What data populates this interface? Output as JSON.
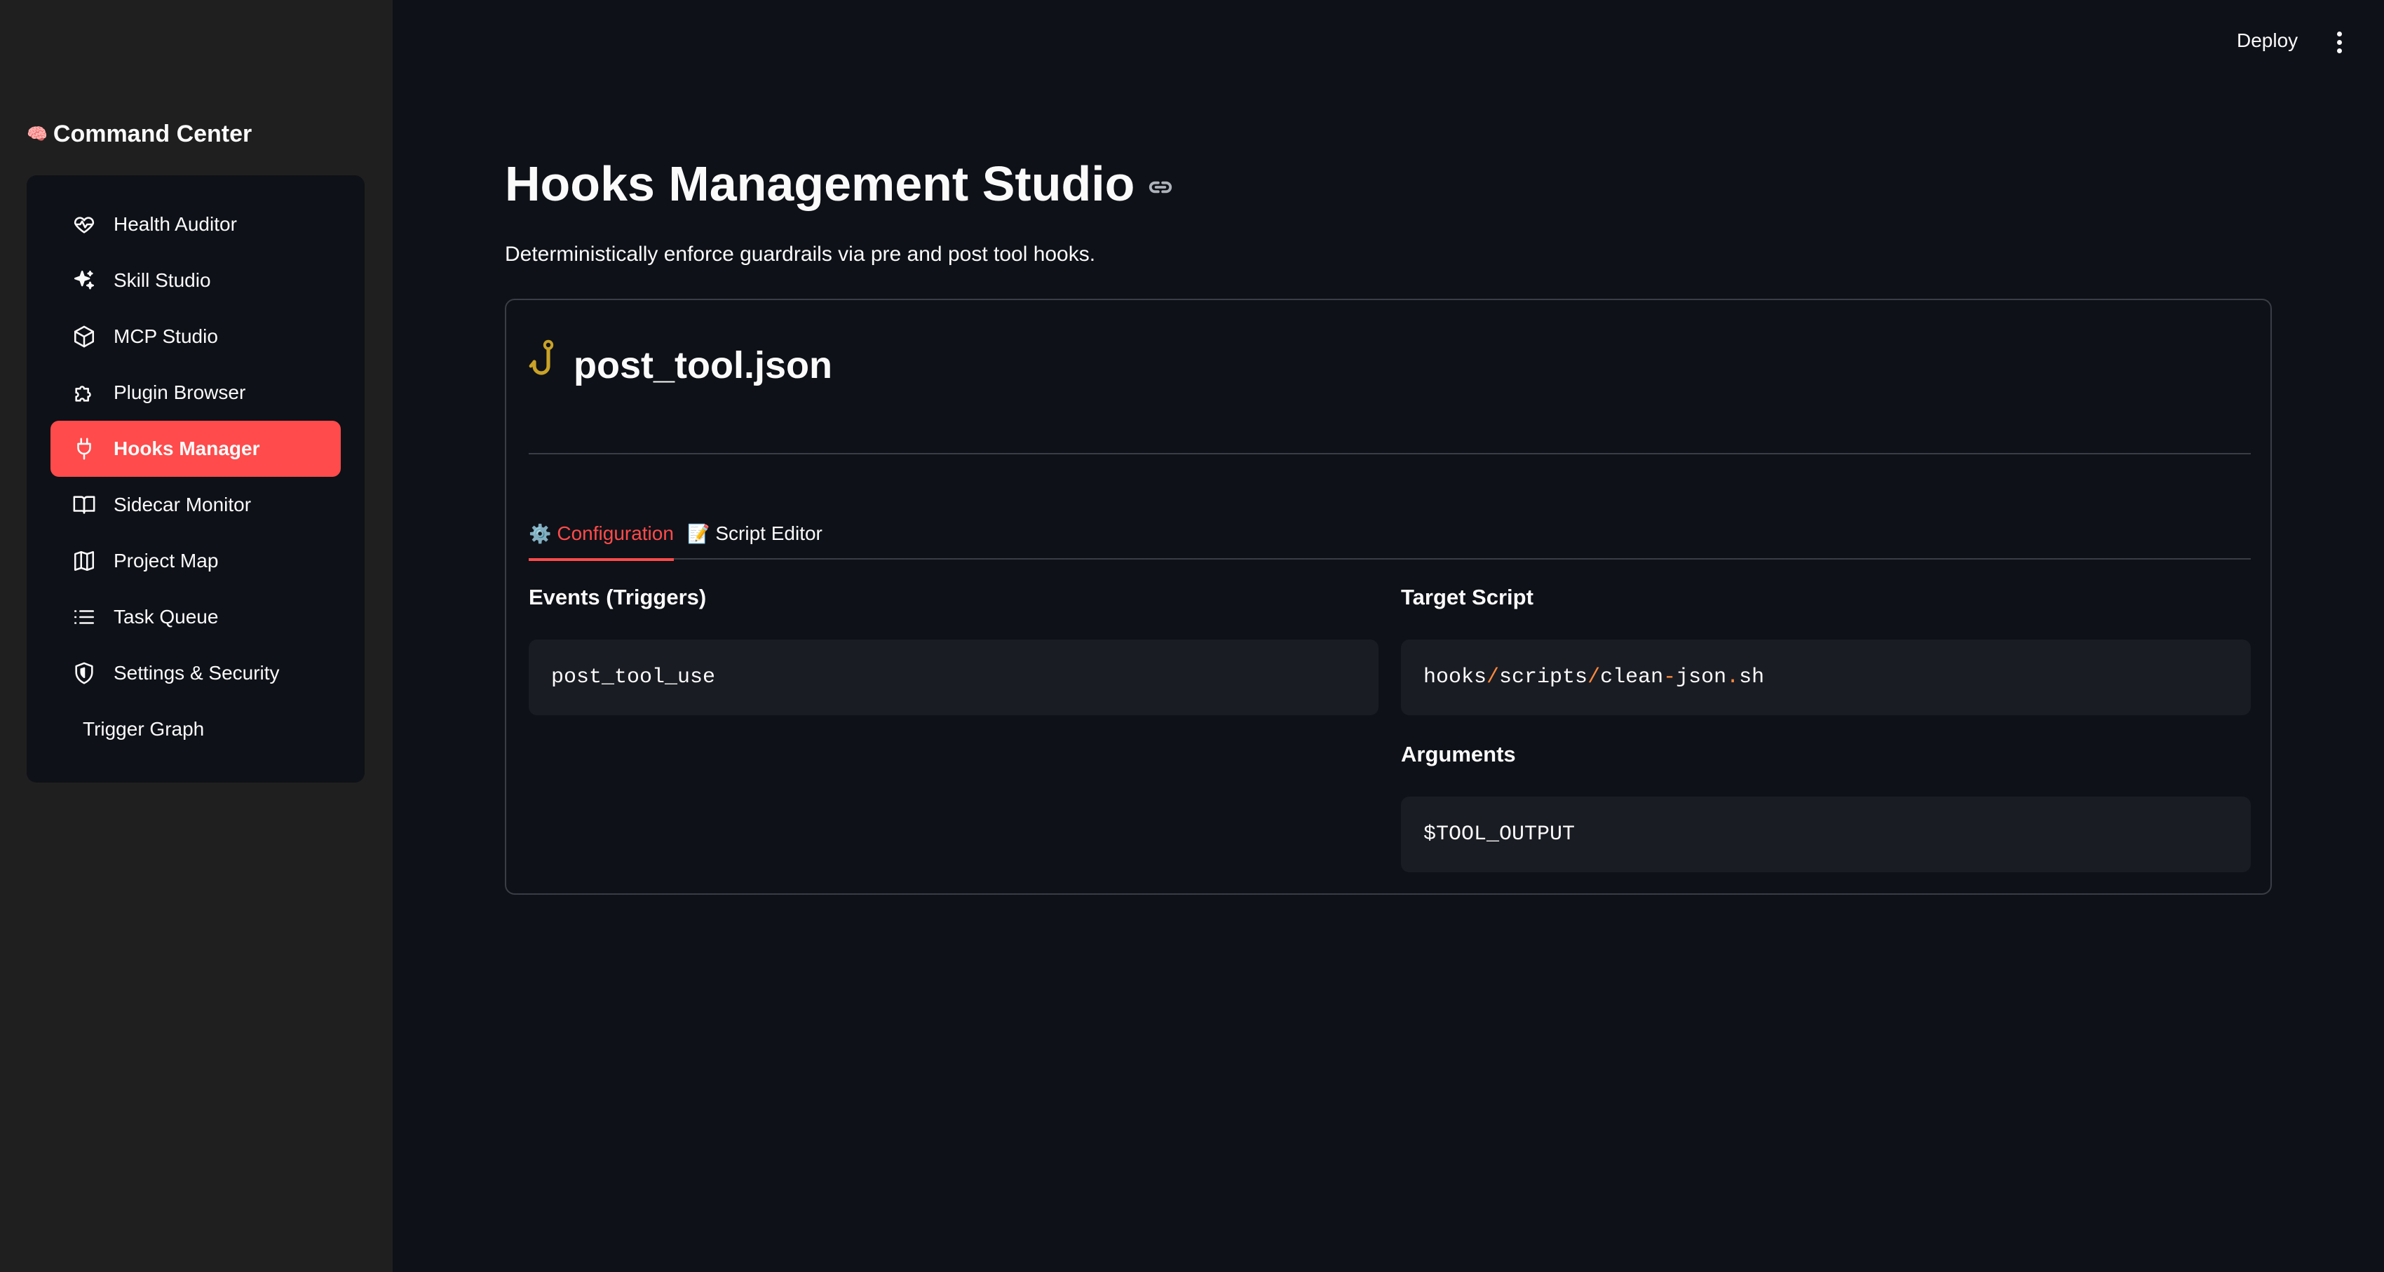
{
  "sidebar": {
    "brand": {
      "icon": "🧠",
      "title": "Command Center"
    },
    "items": [
      {
        "label": "Health Auditor",
        "icon": "heart-pulse-icon",
        "active": false
      },
      {
        "label": "Skill Studio",
        "icon": "sparkles-icon",
        "active": false
      },
      {
        "label": "MCP Studio",
        "icon": "cube-icon",
        "active": false
      },
      {
        "label": "Plugin Browser",
        "icon": "puzzle-icon",
        "active": false
      },
      {
        "label": "Hooks Manager",
        "icon": "plug-icon",
        "active": true
      },
      {
        "label": "Sidecar Monitor",
        "icon": "book-open-icon",
        "active": false
      },
      {
        "label": "Project Map",
        "icon": "map-icon",
        "active": false
      },
      {
        "label": "Task Queue",
        "icon": "list-icon",
        "active": false
      },
      {
        "label": "Settings & Security",
        "icon": "shield-icon",
        "active": false
      },
      {
        "label": "Trigger Graph",
        "icon": "",
        "active": false
      }
    ]
  },
  "topbar": {
    "deploy_label": "Deploy"
  },
  "main": {
    "title": "Hooks Management Studio",
    "subtitle": "Deterministically enforce guardrails via pre and post tool hooks.",
    "card": {
      "file_name": "post_tool.json",
      "file_icon": "hook-icon",
      "tabs": [
        {
          "emoji": "⚙️",
          "label": "Configuration",
          "active": true
        },
        {
          "emoji": "📝",
          "label": "Script Editor",
          "active": false
        }
      ],
      "events_label": "Events (Triggers)",
      "events_value": "post_tool_use",
      "target_label": "Target Script",
      "target_parts": [
        "hooks",
        "/",
        "scripts",
        "/",
        "clean",
        "-",
        "json",
        ".",
        "sh"
      ],
      "arguments_label": "Arguments",
      "arguments_value": "$TOOL_OUTPUT"
    }
  },
  "colors": {
    "accent": "#ff4b4b",
    "background": "#0e1117",
    "sidebar": "#1f1f1f",
    "code_bg": "#1a1c23"
  }
}
